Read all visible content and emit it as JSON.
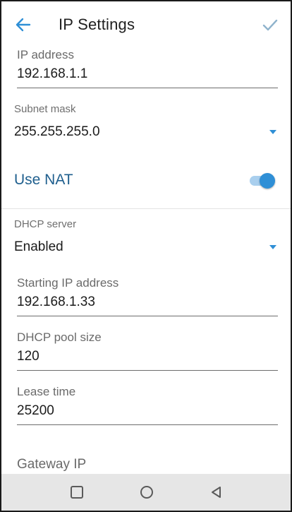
{
  "appbar": {
    "title": "IP Settings",
    "back_icon": "arrow-left-icon",
    "save_icon": "check-icon",
    "accent_color": "#2f8fd6"
  },
  "fields": {
    "ip_address": {
      "label": "IP address",
      "value": "192.168.1.1"
    },
    "subnet_mask": {
      "label": "Subnet mask",
      "value": "255.255.255.0"
    },
    "use_nat": {
      "label": "Use NAT",
      "enabled": true
    },
    "dhcp_server": {
      "label": "DHCP server",
      "value": "Enabled"
    },
    "starting_ip": {
      "label": "Starting IP address",
      "value": "192.168.1.33"
    },
    "pool_size": {
      "label": "DHCP pool size",
      "value": "120"
    },
    "lease_time": {
      "label": "Lease time",
      "value": "25200"
    },
    "gateway_ip": {
      "label": "Gateway IP"
    }
  },
  "navbar": {
    "icons": [
      "recents-square-icon",
      "home-circle-icon",
      "back-triangle-icon"
    ]
  }
}
